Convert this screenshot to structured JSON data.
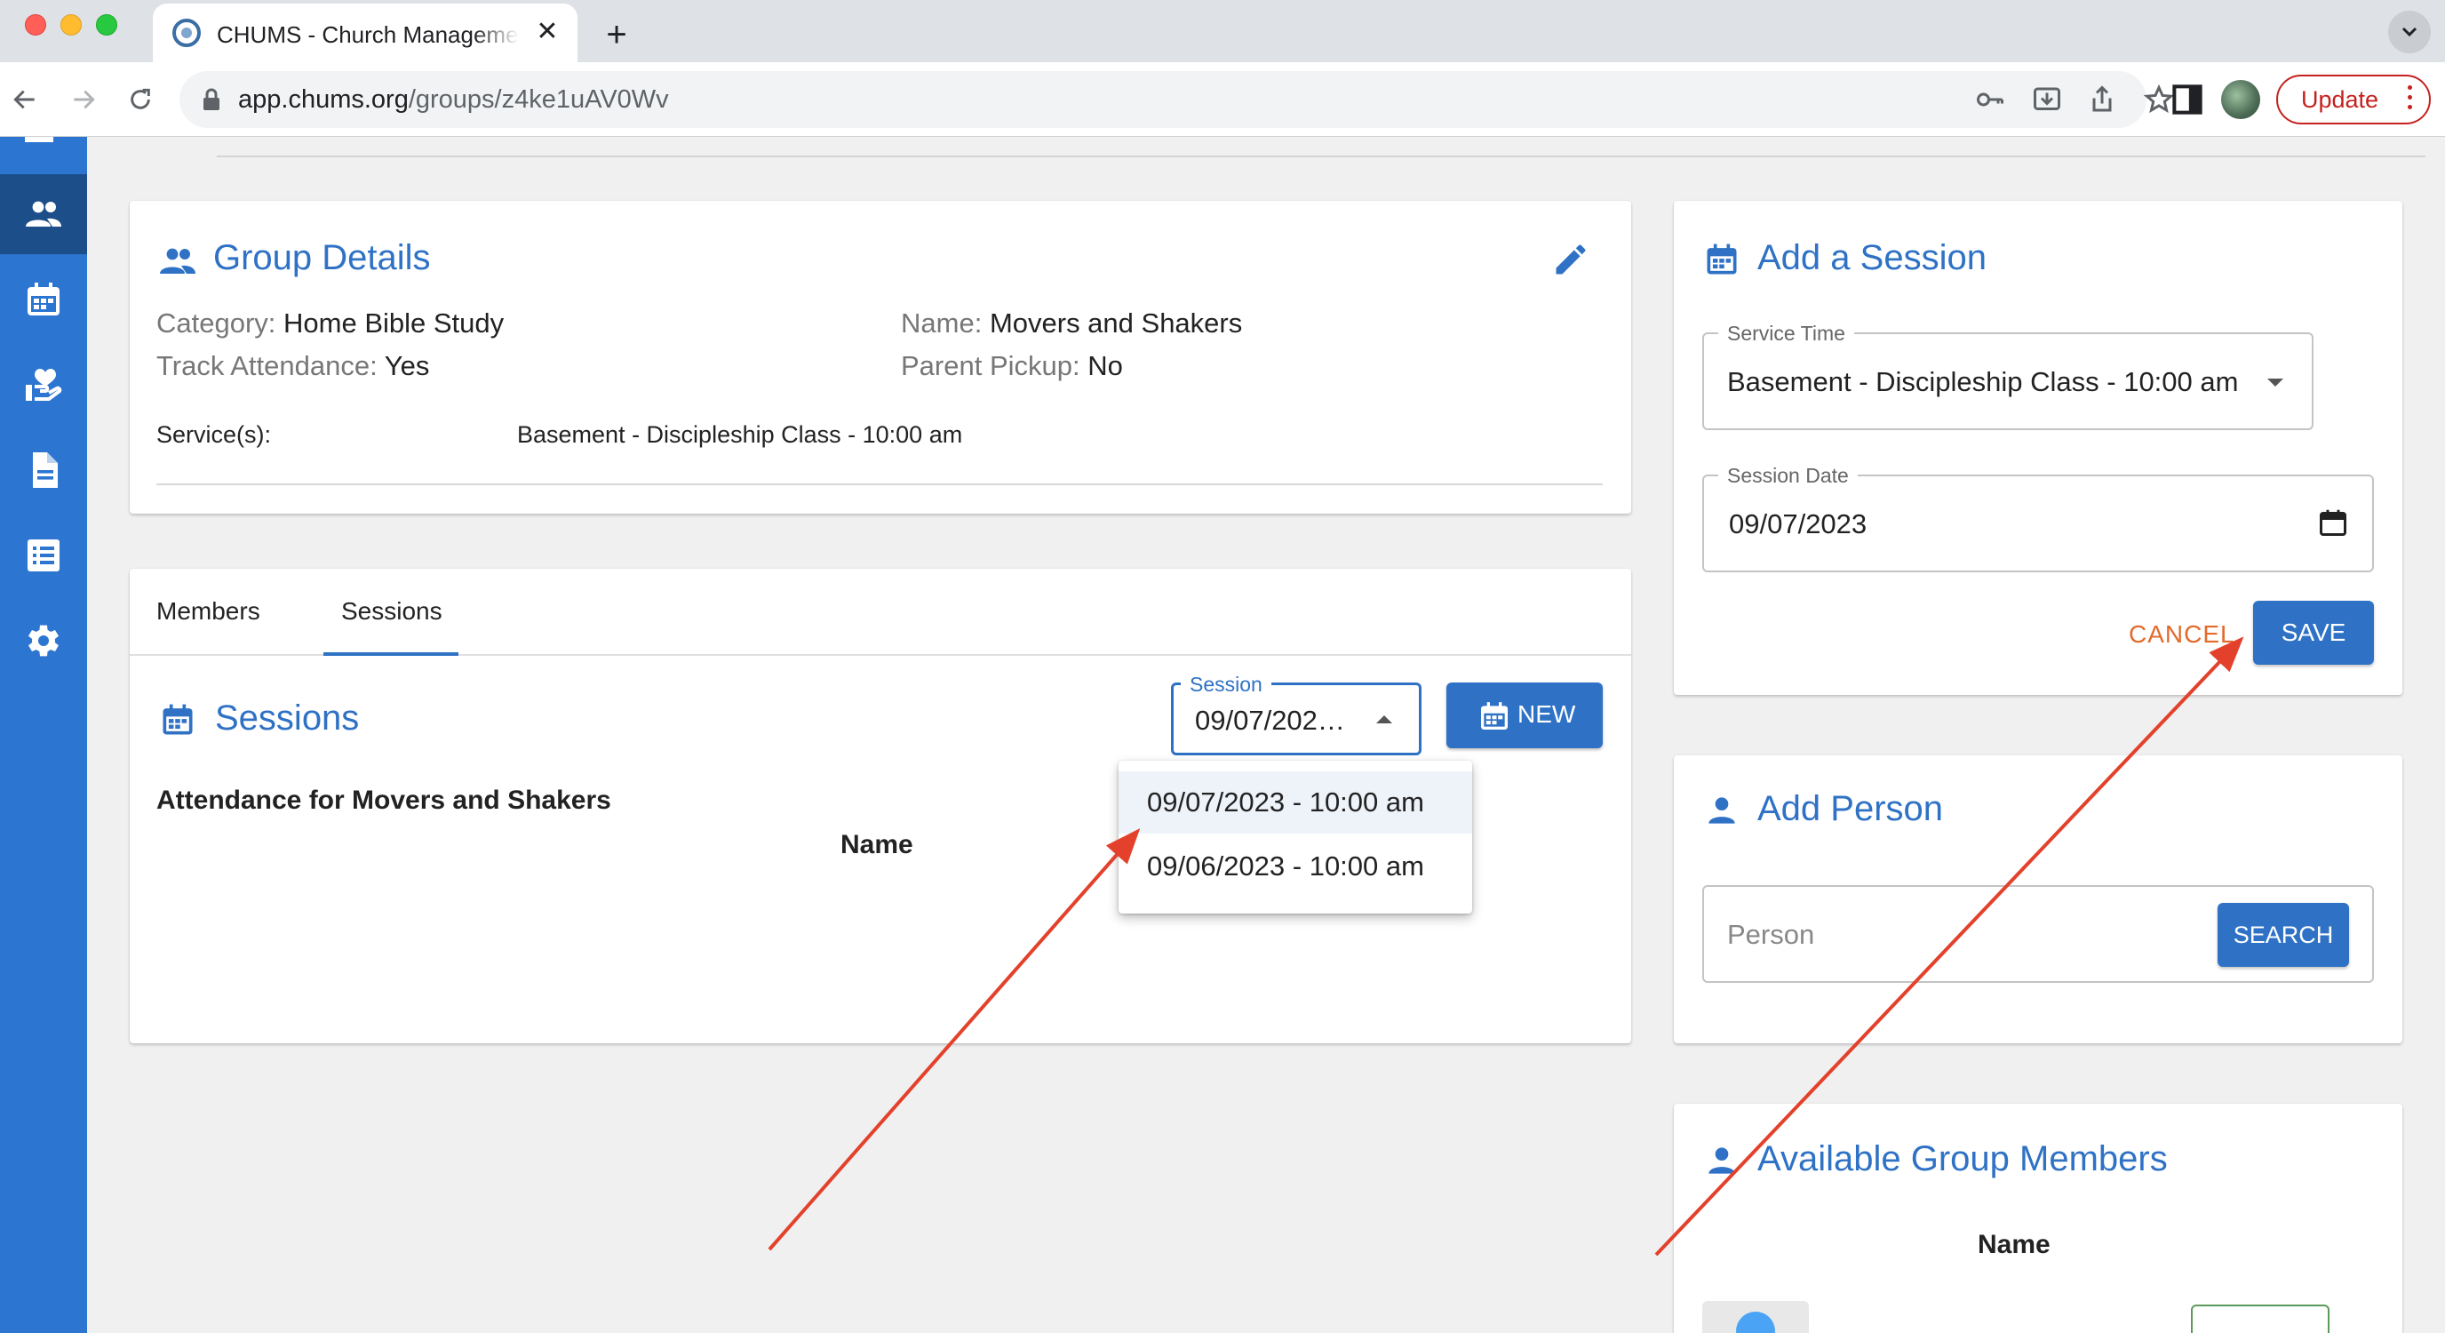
{
  "browser": {
    "tab_title": "CHUMS - Church Management",
    "url_host": "app.chums.org",
    "url_path": "/groups/z4ke1uAV0Wv",
    "update_label": "Update"
  },
  "sidebar": {
    "items": [
      {
        "icon": "people-icon",
        "active": true
      },
      {
        "icon": "calendar-icon",
        "active": false
      },
      {
        "icon": "donation-hand-icon",
        "active": false
      },
      {
        "icon": "document-icon",
        "active": false
      },
      {
        "icon": "list-icon",
        "active": false
      },
      {
        "icon": "gear-icon",
        "active": false
      }
    ]
  },
  "group_details": {
    "title": "Group Details",
    "category_label": "Category:",
    "category_value": "Home Bible Study",
    "name_label": "Name:",
    "name_value": "Movers and Shakers",
    "track_label": "Track Attendance:",
    "track_value": "Yes",
    "pickup_label": "Parent Pickup:",
    "pickup_value": "No",
    "services_label": "Service(s):",
    "services_value": "Basement - Discipleship Class - 10:00 am"
  },
  "tabs": {
    "members": "Members",
    "sessions": "Sessions",
    "active": "Sessions"
  },
  "sessions": {
    "title": "Sessions",
    "session_legend": "Session",
    "session_value": "09/07/202…",
    "new_label": "NEW",
    "attendance_heading": "Attendance for Movers and Shakers",
    "name_header": "Name",
    "options": [
      "09/07/2023 - 10:00 am",
      "09/06/2023 - 10:00 am"
    ]
  },
  "add_session": {
    "title": "Add a Session",
    "service_time_legend": "Service Time",
    "service_time_value": "Basement - Discipleship Class - 10:00 am",
    "session_date_legend": "Session Date",
    "session_date_value": "09/07/2023",
    "cancel_label": "CANCEL",
    "save_label": "SAVE"
  },
  "add_person": {
    "title": "Add Person",
    "placeholder": "Person",
    "search_label": "SEARCH"
  },
  "available_members": {
    "title": "Available Group Members",
    "name_header": "Name"
  },
  "colors": {
    "accent": "#2f72c5",
    "sidebar": "#2c75d1",
    "cancel": "#e36a2b",
    "annotation_arrow": "#e3412b"
  }
}
